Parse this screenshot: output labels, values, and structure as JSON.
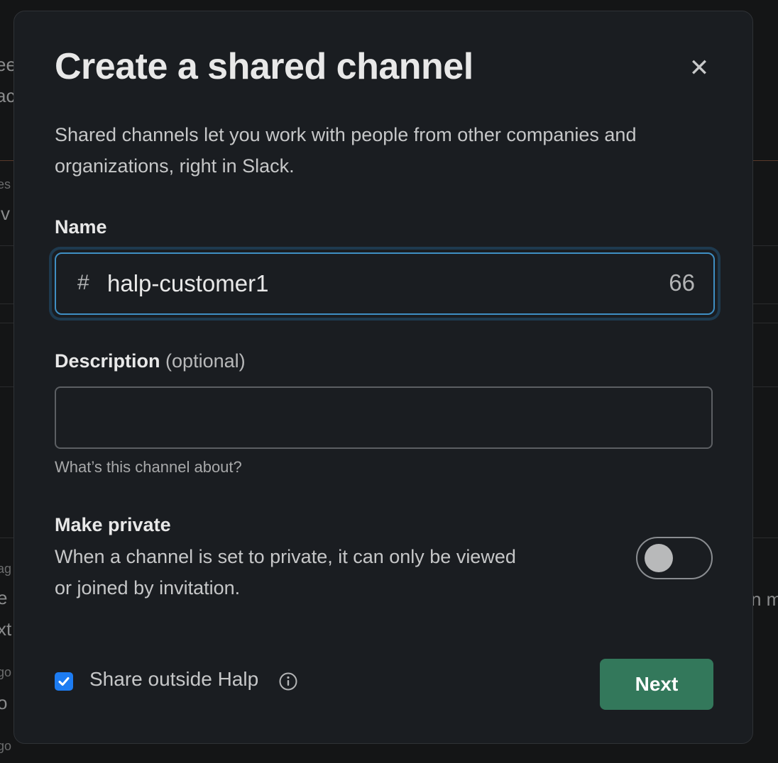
{
  "background": {
    "fragments": [
      "ee",
      "ac",
      "es",
      "'v",
      "ag",
      "e",
      "xt",
      "go",
      "o",
      "go",
      "n m"
    ]
  },
  "modal": {
    "title": "Create a shared channel",
    "close_icon": "close-icon",
    "intro": "Shared channels let you work with people from other companies and organizations, right in Slack.",
    "name": {
      "label": "Name",
      "prefix": "#",
      "value": "halp-customer1",
      "counter": "66"
    },
    "description": {
      "label": "Description",
      "optional": "(optional)",
      "value": "",
      "hint": "What’s this channel about?"
    },
    "private": {
      "label": "Make private",
      "description": "When a channel is set to private, it can only be viewed or joined by invitation.",
      "enabled": false
    },
    "share": {
      "checked": true,
      "label": "Share outside Halp",
      "info_icon": "info-icon"
    },
    "next_label": "Next"
  },
  "colors": {
    "modal_bg": "#1a1d21",
    "focus_border": "#3f8fc4",
    "primary_button": "#33785b",
    "checkbox": "#1d7cf2"
  }
}
